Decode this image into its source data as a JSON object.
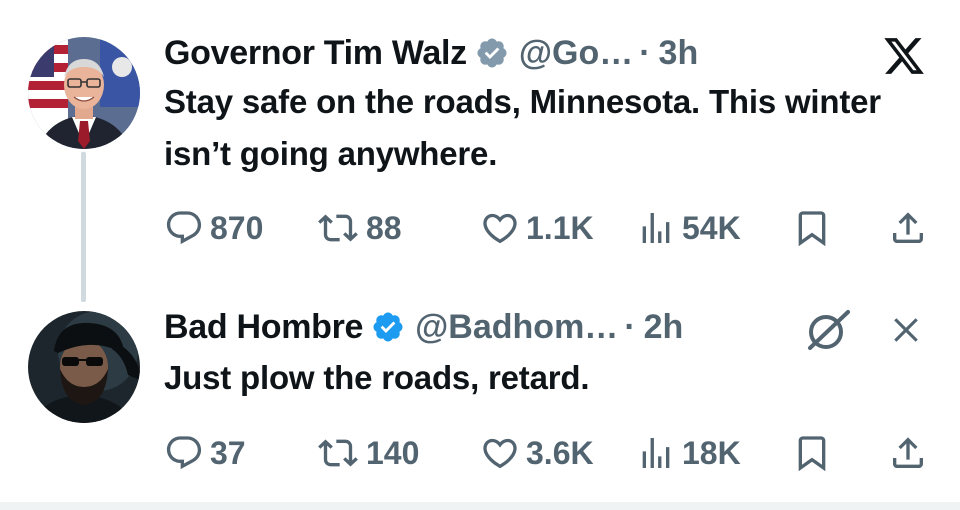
{
  "tweets": [
    {
      "author": {
        "display_name": "Governor Tim Walz",
        "handle": "@Go…",
        "verified_badge": "gray",
        "avatar_icon": "avatar-governor-icon"
      },
      "time": "3h",
      "text": "Stay safe on the roads, Minnesota. This winter isn’t going anywhere.",
      "stats": {
        "replies": "870",
        "reposts": "88",
        "likes": "1.1K",
        "views": "54K"
      },
      "top_right_icon": "x-logo-icon"
    },
    {
      "author": {
        "display_name": "Bad Hombre",
        "handle": "@Badhom…",
        "verified_badge": "blue",
        "avatar_icon": "avatar-bad-hombre-icon"
      },
      "time": "2h",
      "text": "Just plow the roads, retard.",
      "stats": {
        "replies": "37",
        "reposts": "140",
        "likes": "3.6K",
        "views": "18K"
      },
      "top_right_icons": [
        "grok-icon",
        "close-icon"
      ]
    }
  ],
  "separator": "·",
  "colors": {
    "text_primary": "#0f1419",
    "text_secondary": "#536471",
    "verified_blue": "#1d9bf0",
    "verified_gray": "#829aab",
    "thread_line": "#cfd9de"
  }
}
